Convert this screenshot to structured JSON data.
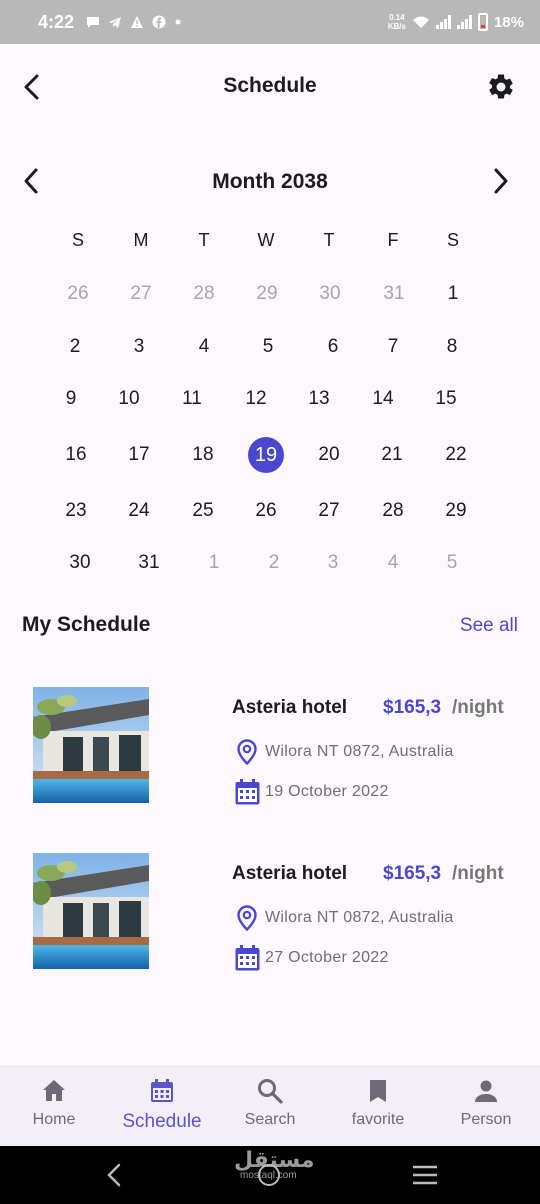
{
  "status_bar": {
    "time": "4:22",
    "net_speed": "0.14",
    "net_unit": "KB/s",
    "battery": "18%"
  },
  "app_bar": {
    "title": "Schedule"
  },
  "calendar": {
    "month_title": "Month 2038",
    "weekdays": [
      "S",
      "M",
      "T",
      "W",
      "T",
      "F",
      "S"
    ],
    "weeks": [
      [
        {
          "d": "26",
          "m": true
        },
        {
          "d": "27",
          "m": true
        },
        {
          "d": "28",
          "m": true
        },
        {
          "d": "29",
          "m": true
        },
        {
          "d": "30",
          "m": true
        },
        {
          "d": "31",
          "m": true
        },
        {
          "d": "1",
          "m": false
        }
      ],
      [
        {
          "d": "2",
          "m": false
        },
        {
          "d": "3",
          "m": false
        },
        {
          "d": "4",
          "m": false
        },
        {
          "d": "5",
          "m": false
        },
        {
          "d": "6",
          "m": false
        },
        {
          "d": "7",
          "m": false
        },
        {
          "d": "8",
          "m": false
        }
      ],
      [
        {
          "d": "9",
          "m": false
        },
        {
          "d": "10",
          "m": false
        },
        {
          "d": "11",
          "m": false
        },
        {
          "d": "12",
          "m": false
        },
        {
          "d": "13",
          "m": false
        },
        {
          "d": "14",
          "m": false
        },
        {
          "d": "15",
          "m": false
        }
      ],
      [
        {
          "d": "16",
          "m": false
        },
        {
          "d": "17",
          "m": false
        },
        {
          "d": "18",
          "m": false
        },
        {
          "d": "19",
          "m": false,
          "selected": true
        },
        {
          "d": "20",
          "m": false
        },
        {
          "d": "21",
          "m": false
        },
        {
          "d": "22",
          "m": false
        }
      ],
      [
        {
          "d": "23",
          "m": false
        },
        {
          "d": "24",
          "m": false
        },
        {
          "d": "25",
          "m": false
        },
        {
          "d": "26",
          "m": false
        },
        {
          "d": "27",
          "m": false
        },
        {
          "d": "28",
          "m": false
        },
        {
          "d": "29",
          "m": false
        }
      ],
      [
        {
          "d": "30",
          "m": false
        },
        {
          "d": "31",
          "m": false
        },
        {
          "d": "1",
          "m": true
        },
        {
          "d": "2",
          "m": true
        },
        {
          "d": "3",
          "m": true
        },
        {
          "d": "4",
          "m": true
        },
        {
          "d": "5",
          "m": true
        }
      ]
    ],
    "selected_color": "#4a47d1"
  },
  "my_schedule": {
    "title": "My Schedule",
    "see_all": "See all",
    "items": [
      {
        "name": "Asteria hotel",
        "price": "$165,3",
        "unit": "/night",
        "location": "Wilora NT 0872, Australia",
        "date": "19 October 2022"
      },
      {
        "name": "Asteria hotel",
        "price": "$165,3",
        "unit": "/night",
        "location": "Wilora NT 0872, Australia",
        "date": "27 October 2022"
      }
    ]
  },
  "bottom_nav": {
    "items": [
      {
        "label": "Home",
        "icon": "home-icon"
      },
      {
        "label": "Schedule",
        "icon": "calendar-icon",
        "active": true
      },
      {
        "label": "Search",
        "icon": "search-icon"
      },
      {
        "label": "favorite",
        "icon": "bookmark-icon"
      },
      {
        "label": "Person",
        "icon": "person-icon"
      }
    ]
  },
  "watermark": {
    "text": "مستقل",
    "sub": "mostaql.com"
  },
  "colors": {
    "accent": "#4a47d1",
    "background": "#fdf8fd",
    "nav_background": "#f4eff6"
  }
}
